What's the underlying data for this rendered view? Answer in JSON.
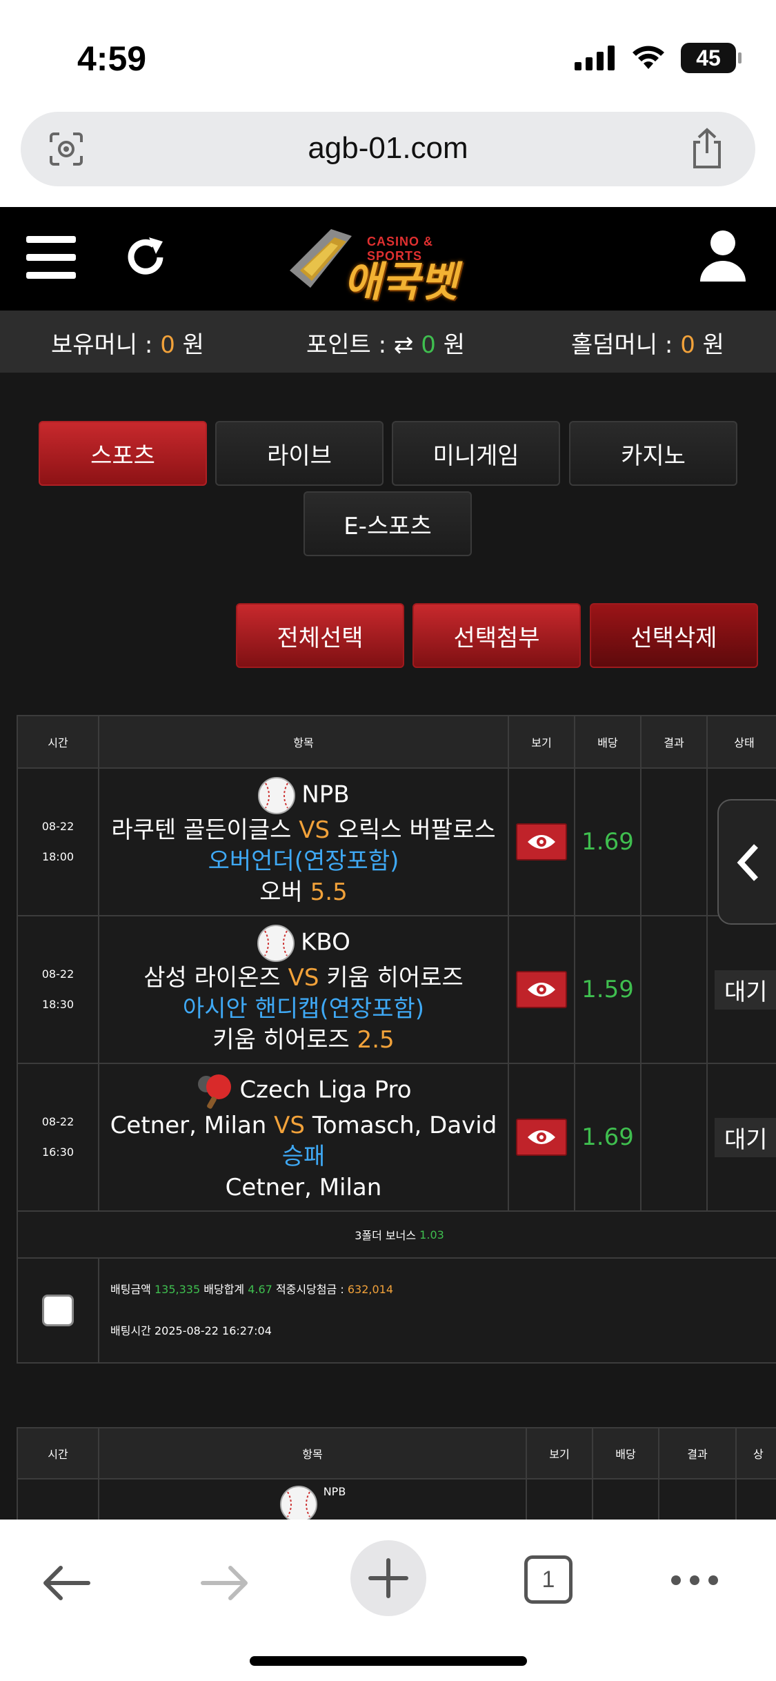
{
  "status_bar": {
    "time": "4:59",
    "battery": "45"
  },
  "browser": {
    "url": "agb-01.com"
  },
  "site": {
    "logo_top": "CASINO & SPORTS",
    "logo_main": "애국벳"
  },
  "money": {
    "holding_label": "보유머니 :",
    "holding_value": "0",
    "point_label": "포인트 :",
    "point_value": "0",
    "holdem_label": "홀덤머니 :",
    "holdem_value": "0",
    "unit": "원"
  },
  "categories": [
    "스포츠",
    "라이브",
    "미니게임",
    "카지노",
    "E-스포츠"
  ],
  "actions": {
    "select_all": "전체선택",
    "attach": "선택첨부",
    "delete": "선택삭제"
  },
  "table1": {
    "headers": [
      "시간",
      "항목",
      "보기",
      "배당",
      "결과",
      "상태"
    ],
    "rows": [
      {
        "date": "08-22",
        "time": "18:00",
        "league": "NPB",
        "home": "라쿠텐 골든이글스",
        "vs": "VS",
        "away": "오릭스 버팔로스",
        "market": "오버언더(연장포함)",
        "pick": "오버",
        "pick_value": "5.5",
        "odds": "1.69",
        "status": ""
      },
      {
        "date": "08-22",
        "time": "18:30",
        "league": "KBO",
        "home": "삼성 라이온즈",
        "vs": "VS",
        "away": "키움 히어로즈",
        "market": "아시안 핸디캡(연장포함)",
        "pick": "키움 히어로즈",
        "pick_value": "2.5",
        "odds": "1.59",
        "status": "대기"
      },
      {
        "date": "08-22",
        "time": "16:30",
        "league": "Czech Liga Pro",
        "home": "Cetner, Milan",
        "vs": "VS",
        "away": "Tomasch, David",
        "market": "승패",
        "pick": "Cetner, Milan",
        "pick_value": "",
        "odds": "1.69",
        "status": "대기"
      }
    ],
    "bonus_label": "3폴더 보너스",
    "bonus_value": "1.03",
    "summary": {
      "amount_label": "배팅금액",
      "amount_value": "135,335",
      "total_odds_label": "배당합계",
      "total_odds_value": "4.67",
      "payout_label": "적중시당첨금 :",
      "payout_value": "632,014",
      "time_label": "배팅시간",
      "time_value": "2025-08-22 16:27:04"
    }
  },
  "table2": {
    "headers": [
      "시간",
      "항목",
      "보기",
      "배당",
      "결과",
      "상"
    ],
    "first_league": "NPB"
  },
  "bottom_bar": {
    "tab_count": "1"
  },
  "colors": {
    "accent_red": "#c8292d",
    "odds_green": "#3fbf4f",
    "market_blue": "#3fa9f5",
    "highlight_orange": "#f2a23a"
  }
}
